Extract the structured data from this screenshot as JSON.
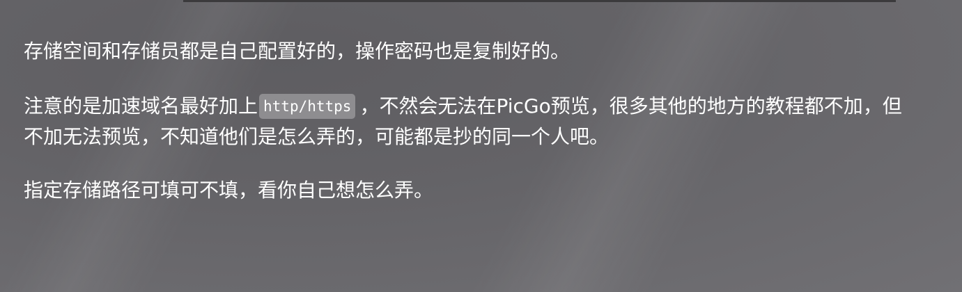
{
  "article": {
    "p1": "存储空间和存储员都是自己配置好的，操作密码也是复制好的。",
    "p2_line1_before": "注意的是加速域名最好加上",
    "p2_code": "http/https",
    "p2_line1_after": "，不然会无法在PicGo预览，很多其他的地方的教程都不加，但",
    "p2_line2": "不加无法预览，不知道他们是怎么弄的，可能都是抄的同一个人吧。",
    "p3": "指定存储路径可填可不填，看你自己想怎么弄。"
  }
}
